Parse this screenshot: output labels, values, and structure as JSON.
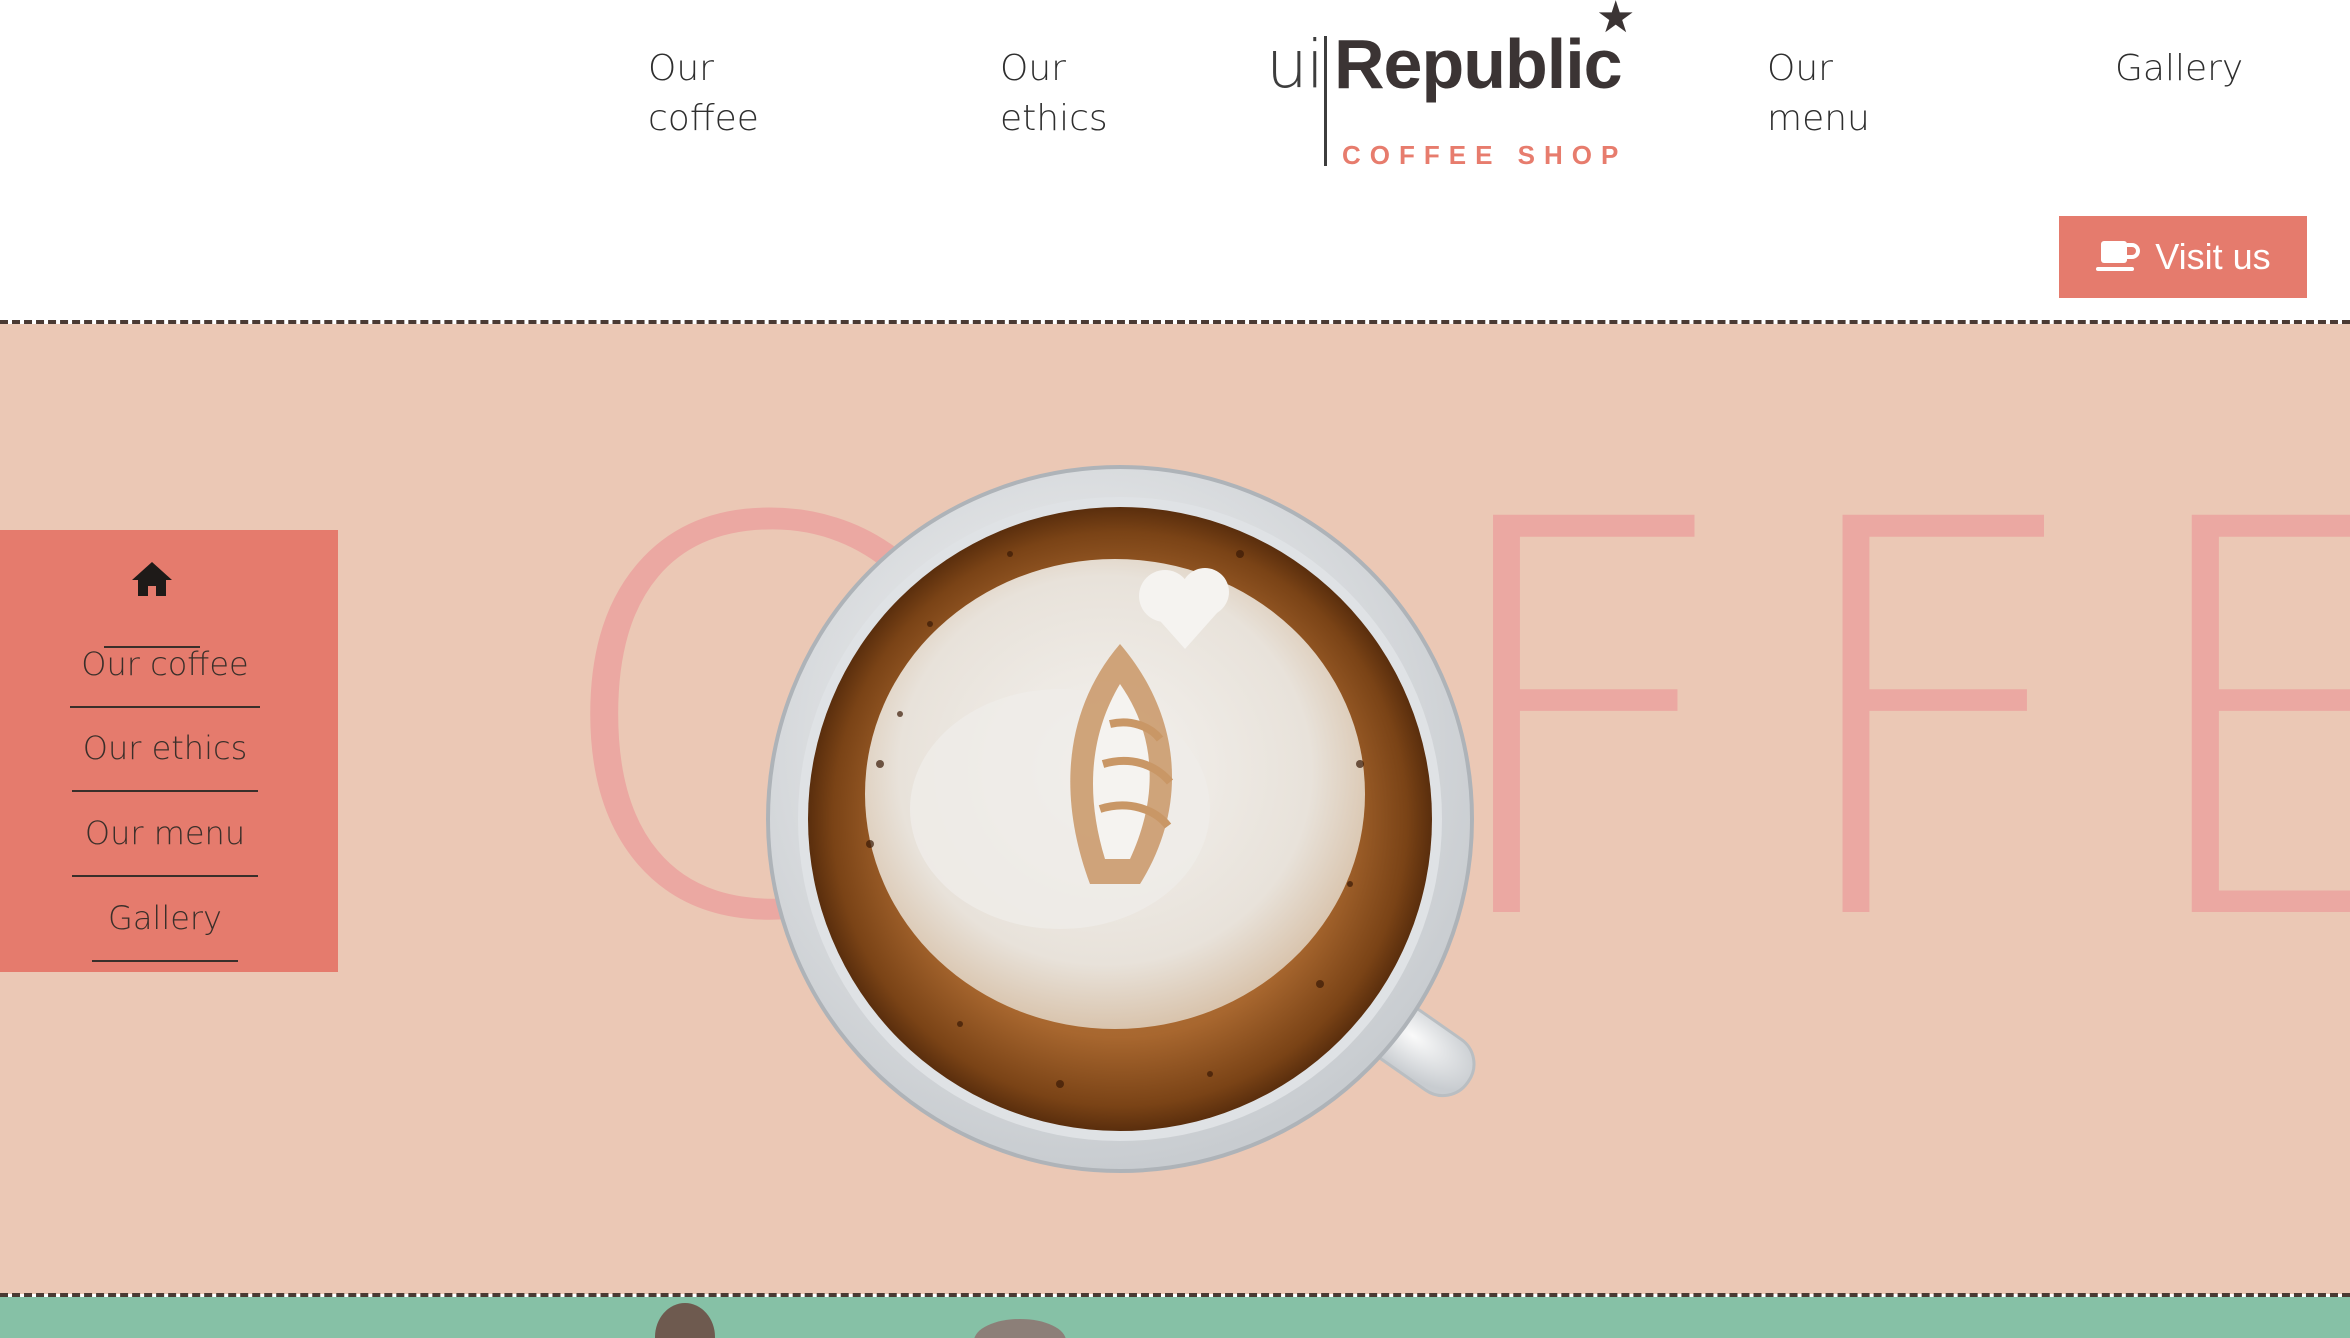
{
  "header": {
    "nav_left": [
      {
        "line1": "Our",
        "line2": "coffee"
      },
      {
        "line1": "Our",
        "line2": "ethics"
      }
    ],
    "nav_right": [
      {
        "line1": "Our",
        "line2": "menu"
      },
      {
        "line1": "Gallery",
        "line2": ""
      }
    ],
    "logo": {
      "prefix": "ui",
      "name": "Republic",
      "tagline": "COFFEE SHOP"
    },
    "visit_button_label": "Visit us"
  },
  "hero": {
    "big_word": "COFFEE",
    "hint_char": "?"
  },
  "side_menu": {
    "items": [
      "Our coffee",
      "Our ethics",
      "Our menu",
      "Gallery"
    ]
  },
  "colors": {
    "accent": "#e57b6d",
    "hero_bg": "#ebc8b5",
    "big_word": "#eba8a2",
    "strip": "#86c1a6"
  }
}
